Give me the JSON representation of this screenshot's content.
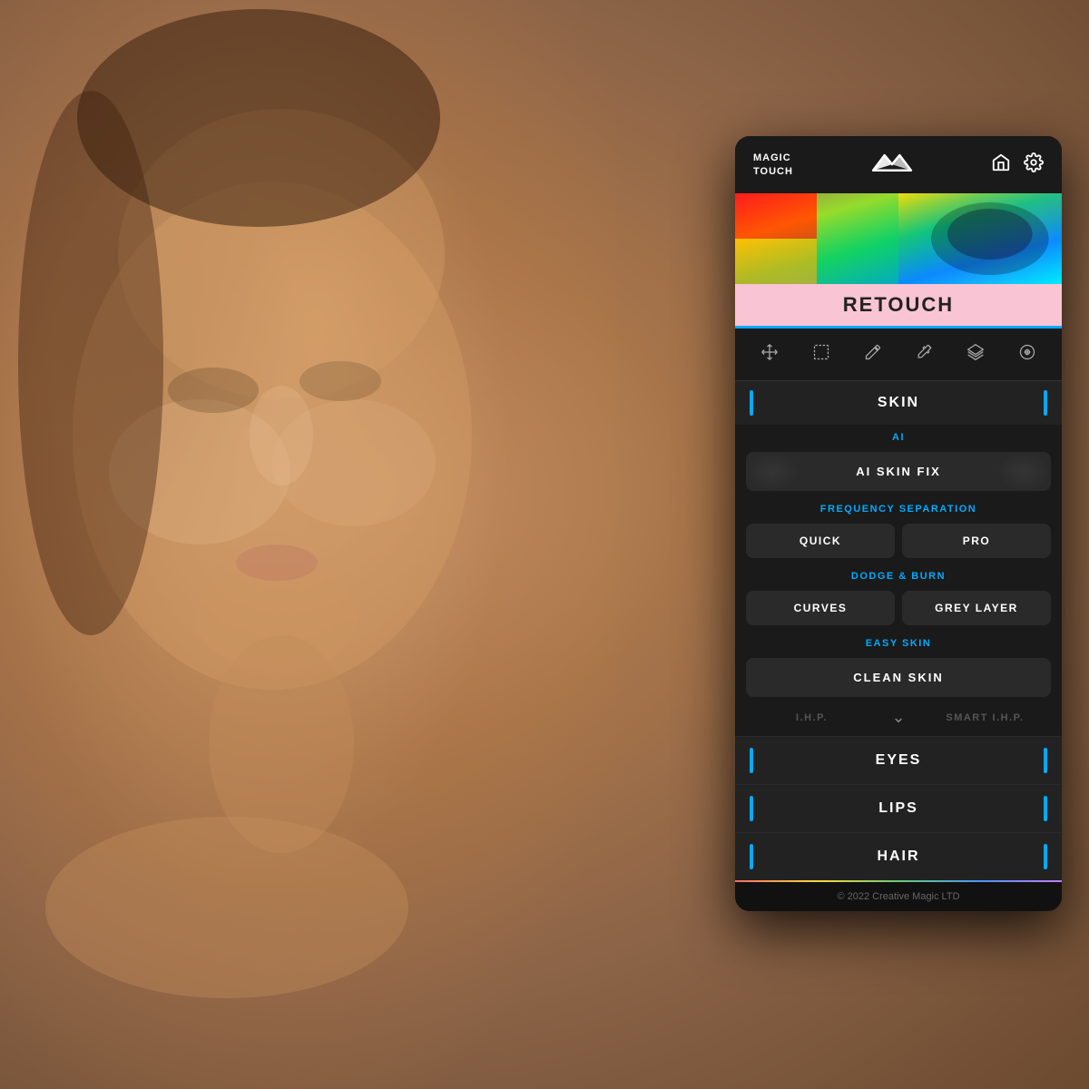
{
  "app": {
    "title": "MAGIC\nTOUCH",
    "title_line1": "MAGIC",
    "title_line2": "TOUCH",
    "logo_alt": "Magic Touch Logo",
    "home_icon": "⌂",
    "settings_icon": "⚙",
    "retouch_label": "RETOUCH",
    "copyright": "© 2022 Creative Magic LTD"
  },
  "toolbar": {
    "move_icon": "✥",
    "select_icon": "⬚",
    "brush_icon": "✏",
    "eyedropper_icon": "💧",
    "layers_icon": "◫",
    "settings_icon": "⚙"
  },
  "skin_section": {
    "label": "SKIN",
    "ai_label": "AI",
    "ai_skin_fix": "AI SKIN FIX",
    "frequency_separation_label": "FREQUENCY SEPARATION",
    "quick_btn": "QUICK",
    "pro_btn": "PRO",
    "dodge_burn_label": "DODGE & BURN",
    "curves_btn": "CURVES",
    "grey_layer_btn": "GREY LAYER",
    "easy_skin_label": "EASY SKIN",
    "clean_skin_btn": "CLEAN SKIN",
    "ihp_btn": "I.H.P.",
    "smart_ihp_btn": "SMART I.H.P."
  },
  "eyes_section": {
    "label": "EYES"
  },
  "lips_section": {
    "label": "LIPS"
  },
  "hair_section": {
    "label": "HAIR"
  },
  "colors": {
    "accent_blue": "#00aaff",
    "panel_bg": "#1a1a1a",
    "button_bg": "#2a2a2a",
    "text_primary": "#ffffff",
    "text_dim": "#555555"
  }
}
